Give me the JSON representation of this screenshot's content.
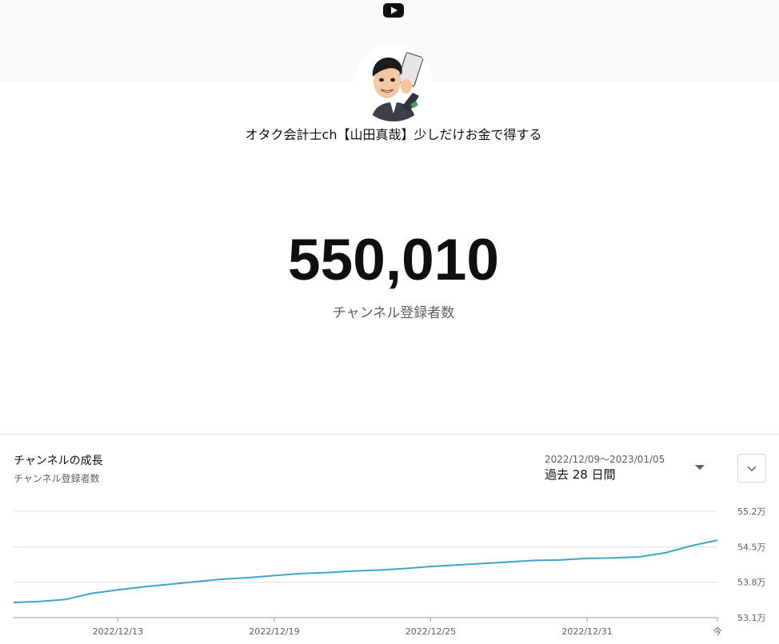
{
  "header": {
    "logo_icon": "youtube-play-icon",
    "accent": "#0f0f0f"
  },
  "channel": {
    "name": "オタク会計士ch【山田真哉】少しだけお金で得する",
    "avatar_icon": "caricature-avatar-icon"
  },
  "subscribers": {
    "count": "550,010",
    "label": "チャンネル登録者数"
  },
  "growth": {
    "title": "チャンネルの成長",
    "subtitle": "チャンネル登録者数",
    "date_range": "2022/12/09〜2023/01/05",
    "period": "過去 28 日間",
    "dropdown_icon": "caret-down-icon",
    "expand_icon": "chevron-down-icon"
  },
  "chart_data": {
    "type": "line",
    "title": "",
    "xlabel": "",
    "ylabel": "",
    "line_color": "#3ea6c9",
    "grid": true,
    "ylim": [
      53.1,
      55.2
    ],
    "y_ticks": [
      {
        "value": 55.2,
        "label": "55.2万"
      },
      {
        "value": 54.5,
        "label": "54.5万"
      },
      {
        "value": 53.8,
        "label": "53.8万"
      },
      {
        "value": 53.1,
        "label": "53.1万"
      }
    ],
    "x_ticks": [
      {
        "day": 4,
        "label": "2022/12/13"
      },
      {
        "day": 10,
        "label": "2022/12/19"
      },
      {
        "day": 16,
        "label": "2022/12/25"
      },
      {
        "day": 22,
        "label": "2022/12/31"
      },
      {
        "day": 27,
        "label": "今"
      }
    ],
    "xlim": [
      0,
      27
    ],
    "series": [
      {
        "name": "",
        "x": [
          0,
          1,
          2,
          3,
          4,
          5,
          6,
          7,
          8,
          9,
          10,
          11,
          12,
          13,
          14,
          15,
          16,
          17,
          18,
          19,
          20,
          21,
          22,
          23,
          24,
          25,
          26,
          27
        ],
        "values": [
          53.4,
          53.42,
          53.46,
          53.58,
          53.65,
          53.71,
          53.76,
          53.81,
          53.86,
          53.89,
          53.93,
          53.97,
          53.99,
          54.02,
          54.04,
          54.07,
          54.11,
          54.14,
          54.17,
          54.2,
          54.23,
          54.24,
          54.27,
          54.28,
          54.3,
          54.38,
          54.52,
          54.63
        ]
      }
    ]
  }
}
